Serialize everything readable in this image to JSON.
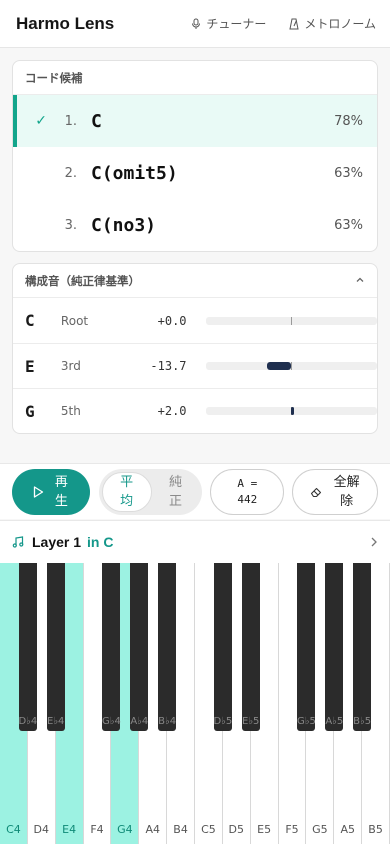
{
  "header": {
    "title": "Harmo Lens",
    "tuner_label": "チューナー",
    "metronome_label": "メトロノーム"
  },
  "candidates": {
    "heading": "コード候補",
    "items": [
      {
        "num": "1.",
        "name": "C",
        "pct": "78%",
        "selected": true
      },
      {
        "num": "2.",
        "name": "C(omit5)",
        "pct": "63%",
        "selected": false
      },
      {
        "num": "3.",
        "name": "C(no3)",
        "pct": "63%",
        "selected": false
      }
    ]
  },
  "tones": {
    "heading": "構成音（純正律基準）",
    "items": [
      {
        "note": "C",
        "role": "Root",
        "cents": "+0.0",
        "value": 0.0
      },
      {
        "note": "E",
        "role": "3rd",
        "cents": "-13.7",
        "value": -13.7
      },
      {
        "note": "G",
        "role": "5th",
        "cents": "+2.0",
        "value": 2.0
      }
    ]
  },
  "controls": {
    "play_label": "再生",
    "equal_label": "平均",
    "just_label": "純正",
    "a_ref_line1": "A =",
    "a_ref_line2": "442",
    "clear_label": "全解除"
  },
  "layer": {
    "name": "Layer 1",
    "key": "in C"
  },
  "keyboard": {
    "white_keys": [
      {
        "label": "C4",
        "active": true
      },
      {
        "label": "D4",
        "active": false
      },
      {
        "label": "E4",
        "active": true
      },
      {
        "label": "F4",
        "active": false
      },
      {
        "label": "G4",
        "active": true
      },
      {
        "label": "A4",
        "active": false
      },
      {
        "label": "B4",
        "active": false
      },
      {
        "label": "C5",
        "active": false
      },
      {
        "label": "D5",
        "active": false
      },
      {
        "label": "E5",
        "active": false
      },
      {
        "label": "F5",
        "active": false
      },
      {
        "label": "G5",
        "active": false
      },
      {
        "label": "A5",
        "active": false
      },
      {
        "label": "B5",
        "active": false
      }
    ],
    "black_keys": [
      {
        "label": "D♭4",
        "after": 0,
        "active": false
      },
      {
        "label": "E♭4",
        "after": 1,
        "active": false
      },
      {
        "label": "G♭4",
        "after": 3,
        "active": false
      },
      {
        "label": "A♭4",
        "after": 4,
        "active": false
      },
      {
        "label": "B♭4",
        "after": 5,
        "active": false
      },
      {
        "label": "D♭5",
        "after": 7,
        "active": false
      },
      {
        "label": "E♭5",
        "after": 8,
        "active": false
      },
      {
        "label": "G♭5",
        "after": 10,
        "active": false
      },
      {
        "label": "A♭5",
        "after": 11,
        "active": false
      },
      {
        "label": "B♭5",
        "after": 12,
        "active": false
      }
    ]
  },
  "colors": {
    "accent": "#14978a",
    "highlight": "#9cf2e2",
    "selected_row_bg": "#e9faf6"
  }
}
